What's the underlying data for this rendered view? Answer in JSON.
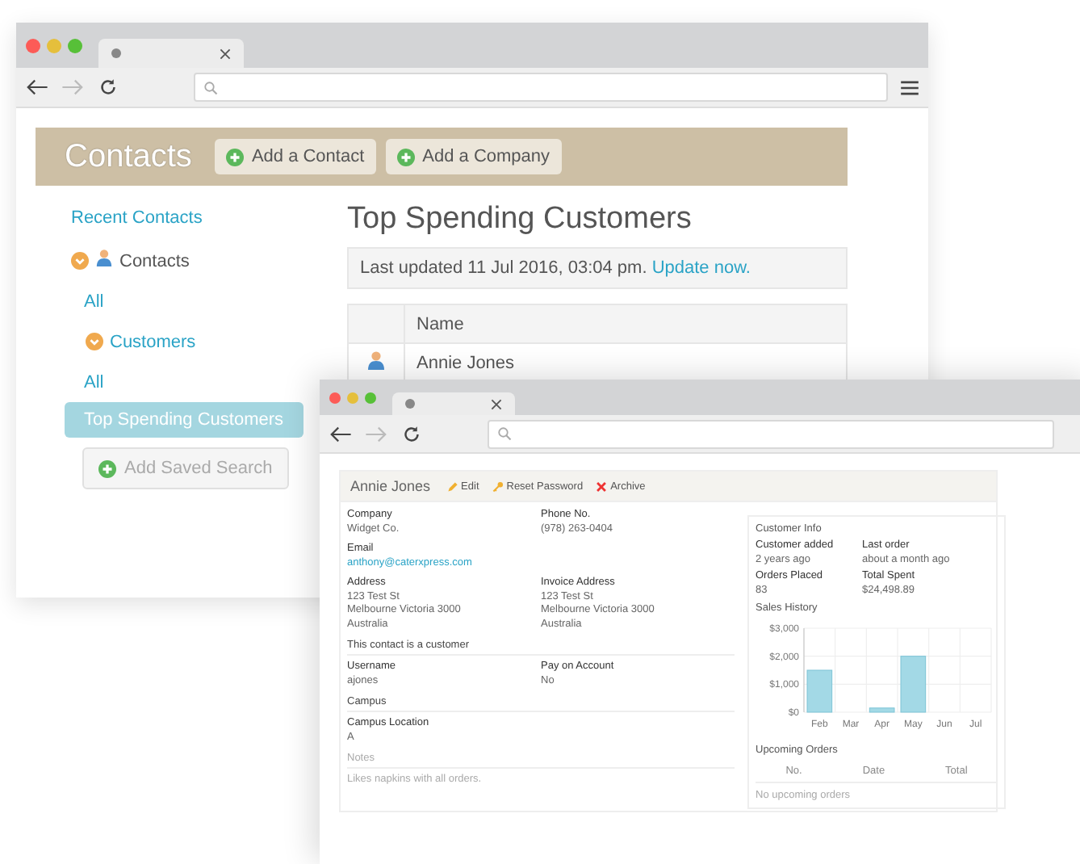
{
  "back_window": {
    "app_title": "Contacts",
    "header_buttons": [
      "Add a Contact",
      "Add a Company"
    ],
    "sidebar": {
      "heading": "Recent Contacts",
      "items": [
        {
          "label": "Contacts",
          "kind": "folder",
          "expanded": true,
          "selected": false,
          "children": [
            {
              "label": "All",
              "kind": "link",
              "selected": false
            },
            {
              "label": "Customers",
              "kind": "group",
              "expanded": true,
              "selected": false,
              "children": [
                {
                  "label": "All",
                  "kind": "link",
                  "selected": false
                },
                {
                  "label": "Top Spending Customers",
                  "kind": "link",
                  "selected": true
                }
              ]
            }
          ]
        }
      ],
      "add_button": "Add Saved Search"
    },
    "main": {
      "title": "Top Spending Customers",
      "last_updated": "Last updated 11 Jul 2016, 03:04 pm.",
      "update_link": "Update now.",
      "table": {
        "columns": [
          "Name"
        ],
        "rows": [
          {
            "name": "Annie Jones"
          }
        ]
      }
    }
  },
  "front_window": {
    "contact_name": "Annie Jones",
    "actions": [
      {
        "label": "Edit",
        "kind": "edit"
      },
      {
        "label": "Reset Password",
        "kind": "password"
      },
      {
        "label": "Archive",
        "kind": "archive"
      }
    ],
    "sections": [
      {
        "kind": "fields",
        "rows": [
          [
            {
              "label": "Company",
              "lines": [
                "Widget Co."
              ]
            },
            {
              "label": "Phone No.",
              "lines": [
                "(978) 263-0404"
              ]
            }
          ],
          [
            {
              "label": "Email",
              "lines": [
                "anthony@caterxpress.com"
              ],
              "link": true
            }
          ],
          [
            {
              "label": "Address",
              "lines": [
                "123 Test St",
                "Melbourne Victoria 3000",
                "Australia"
              ]
            },
            {
              "label": "Invoice Address",
              "lines": [
                "123 Test St",
                "Melbourne Victoria 3000",
                "Australia"
              ]
            }
          ]
        ]
      },
      {
        "kind": "fields",
        "heading": "This contact is a customer",
        "rows": [
          [
            {
              "label": "Username",
              "lines": [
                "ajones"
              ]
            },
            {
              "label": "Pay on Account",
              "lines": [
                "No"
              ]
            }
          ]
        ]
      },
      {
        "kind": "fields",
        "heading": "Campus",
        "rows": [
          [
            {
              "label": "Campus Location",
              "lines": [
                "A"
              ]
            }
          ]
        ]
      },
      {
        "kind": "notes",
        "heading": "Notes",
        "text": "Likes napkins with all orders."
      }
    ],
    "customer_info": {
      "title": "Customer Info",
      "stats": [
        {
          "label": "Customer added",
          "value": "2 years ago"
        },
        {
          "label": "Last order",
          "value": "about a month ago"
        },
        {
          "label": "Orders Placed",
          "value": "83"
        },
        {
          "label": "Total Spent",
          "value": "$24,498.89"
        }
      ],
      "chart_data": {
        "type": "bar",
        "title": "Sales History",
        "categories": [
          "Feb",
          "Mar",
          "Apr",
          "May",
          "Jun",
          "Jul"
        ],
        "values": [
          1500,
          0,
          150,
          2000,
          0,
          0
        ],
        "ylim": [
          0,
          3000
        ],
        "yticks": [
          {
            "value": 0,
            "label": "$0"
          },
          {
            "value": 1000,
            "label": "$1,000"
          },
          {
            "value": 2000,
            "label": "$2,000"
          },
          {
            "value": 3000,
            "label": "$3,000"
          }
        ]
      },
      "upcoming": {
        "title": "Upcoming Orders",
        "columns": [
          "No.",
          "Date",
          "Total"
        ],
        "empty_text": "No upcoming orders"
      }
    }
  }
}
